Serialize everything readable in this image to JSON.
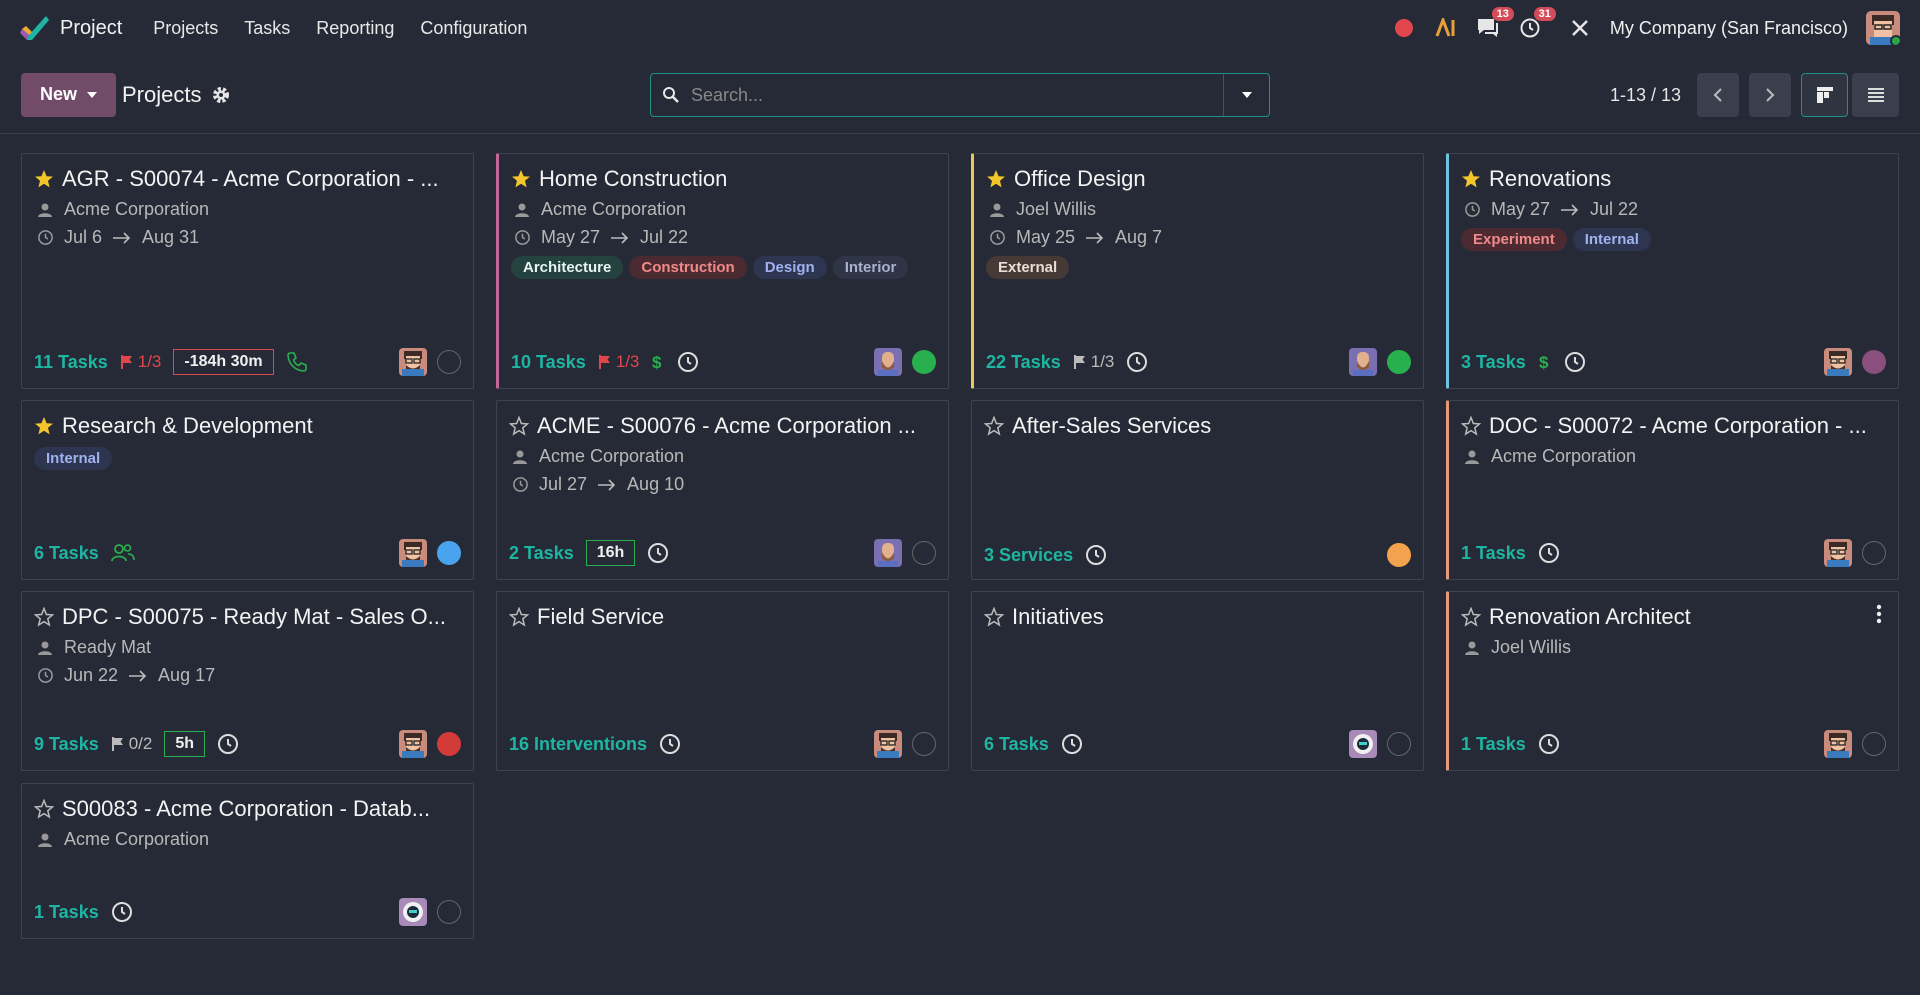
{
  "app": {
    "name": "Project"
  },
  "menu": [
    "Projects",
    "Tasks",
    "Reporting",
    "Configuration"
  ],
  "systray": {
    "messages_count": "13",
    "activities_count": "31",
    "company": "My Company (San Francisco)"
  },
  "control": {
    "new_label": "New",
    "breadcrumb": "Projects",
    "search_placeholder": "Search...",
    "pager": "1-13 / 13"
  },
  "colors": {
    "accent": "#1fb5a3",
    "brand": "#714b67",
    "danger": "#e0474c",
    "border_pink": "#c5669b",
    "border_yellow": "#e9c95b",
    "border_cyan": "#6fc3df",
    "border_salmon": "#e39b7b"
  },
  "cards": [
    {
      "title": "AGR - S00074 - Acme Corporation - ...",
      "starred": true,
      "customer": "Acme Corporation",
      "date_start": "Jul 6",
      "date_end": "Aug 31",
      "tasks": "11 Tasks",
      "milestone": "1/3",
      "milestone_red": true,
      "timebox": "-184h 30m",
      "timebox_style": "red",
      "extra_icon": "phone-icon",
      "status": "empty",
      "avatar": "man"
    },
    {
      "title": "Home Construction",
      "starred": true,
      "customer": "Acme Corporation",
      "date_start": "May 27",
      "date_end": "Jul 22",
      "tags": [
        "Architecture",
        "Construction",
        "Design",
        "Interior"
      ],
      "tasks": "10 Tasks",
      "milestone": "1/3",
      "milestone_red": true,
      "extra_icon": "dollar-icon",
      "clock": true,
      "status": "green",
      "avatar": "bearded",
      "border": "pink"
    },
    {
      "title": "Office Design",
      "starred": true,
      "customer": "Joel Willis",
      "date_start": "May 25",
      "date_end": "Aug 7",
      "tags": [
        "External"
      ],
      "tasks": "22 Tasks",
      "milestone": "1/3",
      "milestone_red": false,
      "clock": true,
      "status": "green",
      "avatar": "bearded",
      "border": "yellow"
    },
    {
      "title": "Renovations",
      "starred": true,
      "date_start": "May 27",
      "date_end": "Jul 22",
      "tags": [
        "Experiment",
        "Internal"
      ],
      "tasks": "3 Tasks",
      "extra_icon": "dollar-icon",
      "clock": true,
      "status": "purple",
      "avatar": "man",
      "border": "cyan"
    },
    {
      "title": "Research & Development",
      "starred": true,
      "tags": [
        "Internal"
      ],
      "tasks": "6 Tasks",
      "extra_icon": "users-icon",
      "status": "blue",
      "avatar": "man"
    },
    {
      "title": "ACME - S00076 - Acme Corporation ...",
      "starred": false,
      "customer": "Acme Corporation",
      "date_start": "Jul 27",
      "date_end": "Aug 10",
      "tasks": "2 Tasks",
      "timebox": "16h",
      "timebox_style": "green",
      "clock": true,
      "status": "empty",
      "avatar": "bearded"
    },
    {
      "title": "After-Sales Services",
      "starred": false,
      "tasks": "3 Services",
      "clock": true,
      "status": "orange",
      "avatar": ""
    },
    {
      "title": "DOC - S00072 - Acme Corporation - ...",
      "starred": false,
      "customer": "Acme Corporation",
      "tasks": "1 Tasks",
      "clock": true,
      "status": "empty",
      "avatar": "man",
      "border": "salmon"
    },
    {
      "title": "DPC - S00075 - Ready Mat - Sales O...",
      "starred": false,
      "customer": "Ready Mat",
      "date_start": "Jun 22",
      "date_end": "Aug 17",
      "tasks": "9 Tasks",
      "milestone": "0/2",
      "milestone_red": false,
      "timebox": "5h",
      "timebox_style": "green",
      "clock": true,
      "status": "red",
      "avatar": "man"
    },
    {
      "title": "Field Service",
      "starred": false,
      "tasks": "16 Interventions",
      "clock": true,
      "status": "empty",
      "avatar": "man"
    },
    {
      "title": "Initiatives",
      "starred": false,
      "tasks": "6 Tasks",
      "clock": true,
      "status": "empty",
      "avatar": "bot"
    },
    {
      "title": "Renovation Architect",
      "starred": false,
      "customer": "Joel Willis",
      "tasks": "1 Tasks",
      "clock": true,
      "status": "empty",
      "avatar": "man",
      "border": "salmon",
      "kebab": true
    },
    {
      "title": "S00083 - Acme Corporation - Datab...",
      "starred": false,
      "customer": "Acme Corporation",
      "tasks": "1 Tasks",
      "clock": true,
      "status": "empty",
      "avatar": "bot"
    }
  ]
}
